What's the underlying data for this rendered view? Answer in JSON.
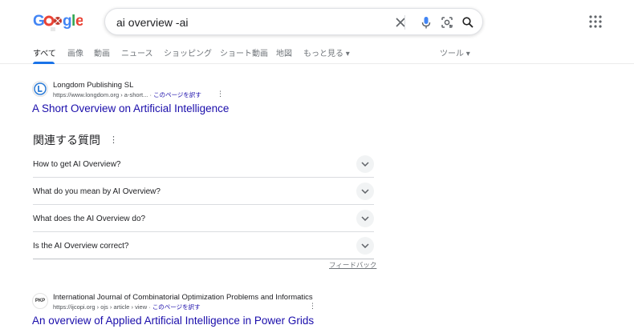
{
  "search": {
    "query": "ai overview -ai"
  },
  "icons": {
    "clear": "close-icon",
    "voice": "microphone-icon",
    "lens": "camera-lens-icon",
    "search": "search-icon",
    "apps": "apps-grid-icon"
  },
  "tabs": [
    {
      "label": "すべて"
    },
    {
      "label": "画像"
    },
    {
      "label": "動画"
    },
    {
      "label": "ニュース"
    },
    {
      "label": "ショッピング"
    },
    {
      "label": "ショート動画"
    },
    {
      "label": "地図"
    },
    {
      "label": "もっと見る ▾"
    },
    {
      "label": "ツール ▾"
    }
  ],
  "results": [
    {
      "site_name": "Longdom Publishing SL",
      "url": "https://www.longdom.org › a-short...",
      "translate": "このページを訳す",
      "title": "A Short Overview on Artificial Intelligence"
    },
    {
      "favicon_text": "PKP",
      "site_name": "International Journal of Combinatorial Optimization Problems and Informatics",
      "url": "https://ijcopi.org › ojs › article › view",
      "translate": "このページを訳す",
      "title": "An overview of Applied Artificial Intelligence in Power Grids"
    }
  ],
  "paa": {
    "heading": "関連する質問",
    "questions": [
      "How to get AI Overview?",
      "What do you mean by AI Overview?",
      "What does the AI Overview do?",
      "Is the AI Overview correct?"
    ],
    "feedback": "フィードバック"
  },
  "colors": {
    "link": "#1a0dab",
    "accent": "#1a73e8"
  }
}
